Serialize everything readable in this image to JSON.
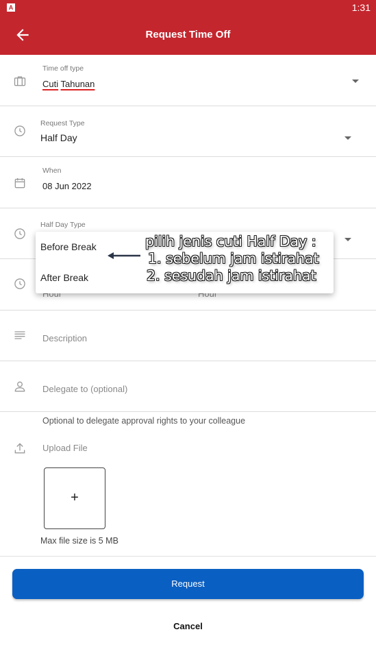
{
  "status_bar": {
    "time": "1:31",
    "app_badge": "A"
  },
  "app_bar": {
    "title": "Request Time Off",
    "back_icon": "arrow-left-icon"
  },
  "form": {
    "time_off_type": {
      "label": "Time off type",
      "value_word1": "Cuti",
      "value_word2": "Tahunan",
      "icon": "briefcase-icon"
    },
    "request_type": {
      "label": "Request Type",
      "value": "Half Day",
      "icon": "clock-icon"
    },
    "when": {
      "label": "When",
      "value": "08 Jun 2022",
      "icon": "calendar-icon"
    },
    "half_day_type": {
      "label": "Half Day Type",
      "icon": "clock-icon"
    },
    "hours": {
      "start_placeholder": "Hour",
      "end_placeholder": "Hour",
      "icon": "clock-icon"
    },
    "description": {
      "placeholder": "Description",
      "icon": "notes-icon"
    },
    "delegate": {
      "placeholder": "Delegate to (optional)",
      "helper": "Optional to delegate approval rights to your colleague",
      "icon": "person-icon"
    },
    "upload": {
      "label": "Upload File",
      "plus": "+",
      "max_size": "Max file size is 5 MB",
      "icon": "upload-icon"
    }
  },
  "dropdown": {
    "options": [
      "Before Break",
      "After Break"
    ]
  },
  "annotation": {
    "line1": "pilih jenis cuti Half Day :",
    "line2": "1. sebelum jam istirahat",
    "line3": "2. sesudah jam istirahat"
  },
  "actions": {
    "request_label": "Request",
    "cancel_label": "Cancel"
  },
  "colors": {
    "header": "#c4262e",
    "primary_button": "#0a5fc2"
  }
}
